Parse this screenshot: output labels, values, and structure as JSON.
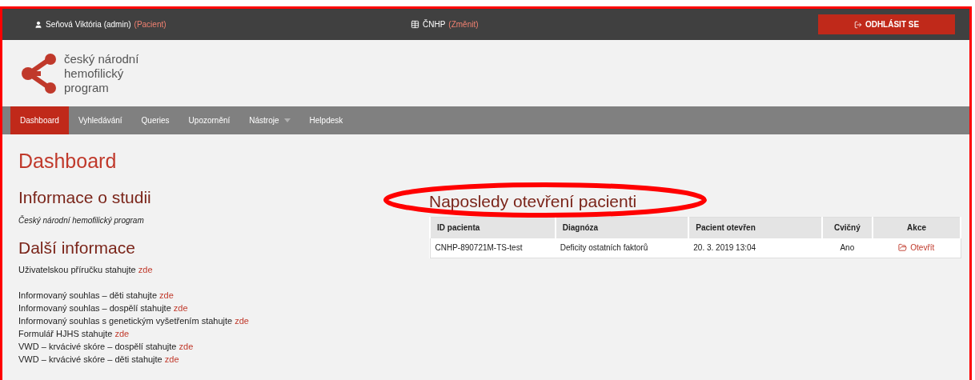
{
  "top_bar": {
    "user": "Seňová Viktória (admin)",
    "role_link": "(Pacient)",
    "program": "ČNHP",
    "change_link": "(Změnit)",
    "logout_button": "ODHLÁSIT SE"
  },
  "logo": {
    "lines": [
      "český národní",
      "hemofilický",
      "program"
    ]
  },
  "nav": [
    {
      "label": "Dashboard",
      "selected": true,
      "has_menu": false
    },
    {
      "label": "Vyhledávání",
      "selected": false,
      "has_menu": false
    },
    {
      "label": "Queries",
      "selected": false,
      "has_menu": false
    },
    {
      "label": "Upozornění",
      "selected": false,
      "has_menu": false
    },
    {
      "label": "Nástroje",
      "selected": false,
      "has_menu": true
    },
    {
      "label": "Helpdesk",
      "selected": false,
      "has_menu": false
    }
  ],
  "page_title": "Dashboard",
  "study": {
    "heading": "Informace o studii",
    "name": "Český národní hemofilický program"
  },
  "more_info": {
    "heading": "Další informace",
    "manual": {
      "text": "Uživatelskou příručku stahujte",
      "link": "zde"
    },
    "documents": [
      {
        "text": "Informovaný souhlas – děti stahujte",
        "link": "zde"
      },
      {
        "text": "Informovaný souhlas – dospělí stahujte",
        "link": "zde"
      },
      {
        "text": "Informovaný souhlas s genetickým vyšetřením stahujte",
        "link": "zde"
      },
      {
        "text": "Formulář HJHS stahujte",
        "link": "zde"
      },
      {
        "text": "VWD – krvácivé skóre – dospělí stahujte",
        "link": "zde"
      },
      {
        "text": "VWD – krvácivé skóre – děti stahujte",
        "link": "zde"
      }
    ]
  },
  "recent_patients": {
    "heading": "Naposledy otevření pacienti",
    "highlighted": true,
    "columns": [
      "ID pacienta",
      "Diagnóza",
      "Pacient otevřen",
      "Cvičný",
      "Akce"
    ],
    "rows": [
      {
        "id": "CNHP-890721M-TS-test",
        "diagnosis": "Deficity ostatních faktorů",
        "opened": "20. 3. 2019 13:04",
        "practice": "Ano",
        "action": "Otevřít"
      }
    ]
  }
}
